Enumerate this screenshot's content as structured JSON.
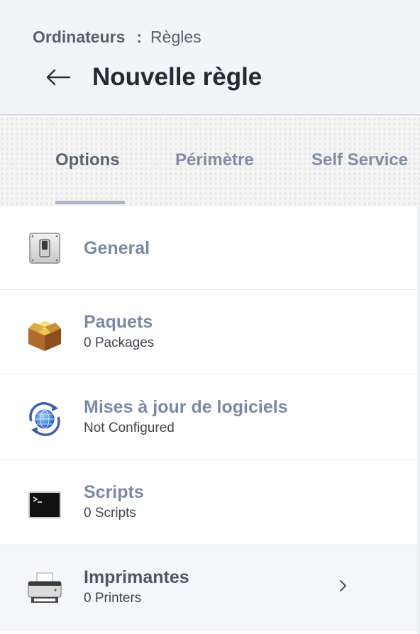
{
  "breadcrumb": {
    "root": "Ordinateurs",
    "separator": ":",
    "current": "Règles"
  },
  "header": {
    "title": "Nouvelle règle",
    "back_icon": "arrow-left-icon"
  },
  "tabs": [
    {
      "label": "Options",
      "selected": true
    },
    {
      "label": "Périmètre",
      "selected": false
    },
    {
      "label": "Self Service",
      "selected": false
    }
  ],
  "items": [
    {
      "title": "General",
      "subtitle": "",
      "icon": "switch-icon"
    },
    {
      "title": "Paquets",
      "subtitle": "0 Packages",
      "icon": "package-box-icon"
    },
    {
      "title": "Mises à jour de logiciels",
      "subtitle": "Not Configured",
      "icon": "software-update-globe-icon"
    },
    {
      "title": "Scripts",
      "subtitle": "0 Scripts",
      "icon": "terminal-icon"
    },
    {
      "title": "Imprimantes",
      "subtitle": "0 Printers",
      "icon": "printer-icon",
      "active": true
    }
  ],
  "colors": {
    "header_bg": "#f3f4f8",
    "tab_accent": "#a8b6cc",
    "item_title": "#7a8aa3",
    "active_row_bg": "#f5f6f9"
  }
}
